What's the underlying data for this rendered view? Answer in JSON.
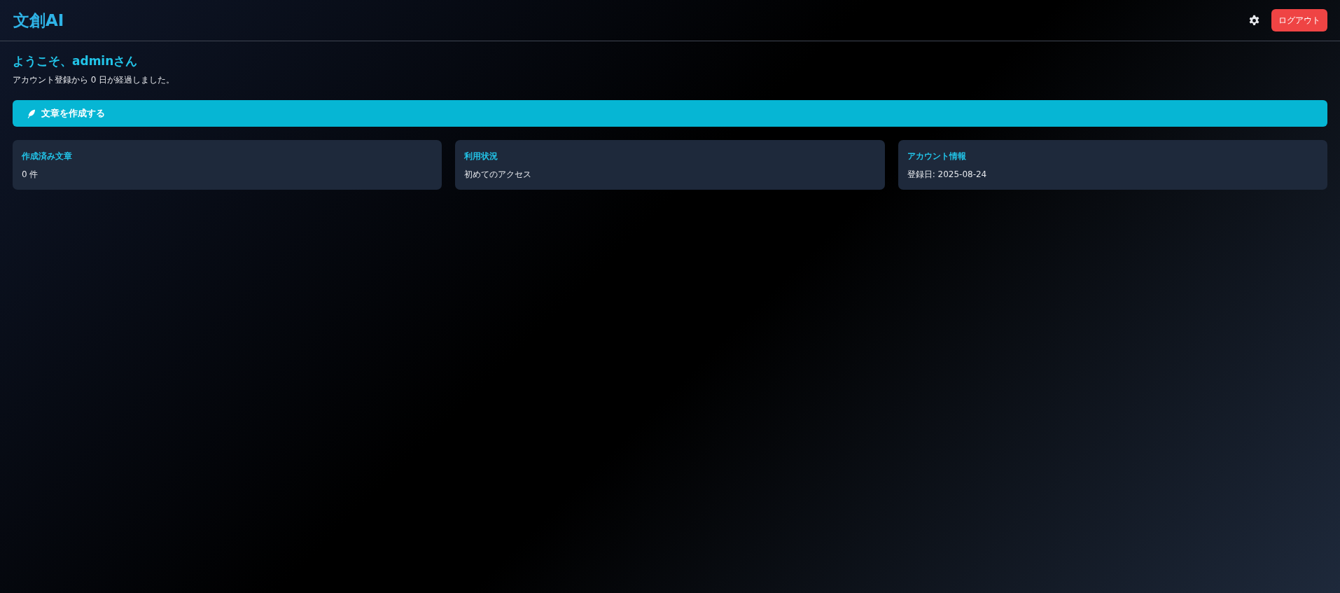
{
  "header": {
    "logo": "文創AI",
    "logout_button": "ログアウト"
  },
  "welcome": {
    "title": "ようこそ、adminさん",
    "subtitle": "アカウント登録から 0 日が経過しました。"
  },
  "create_button": {
    "label": "文章を作成する"
  },
  "cards": [
    {
      "title": "作成済み文章",
      "value": "0 件"
    },
    {
      "title": "利用状況",
      "value": "初めてのアクセス"
    },
    {
      "title": "アカウント情報",
      "value": "登録日: 2025-08-24"
    }
  ]
}
